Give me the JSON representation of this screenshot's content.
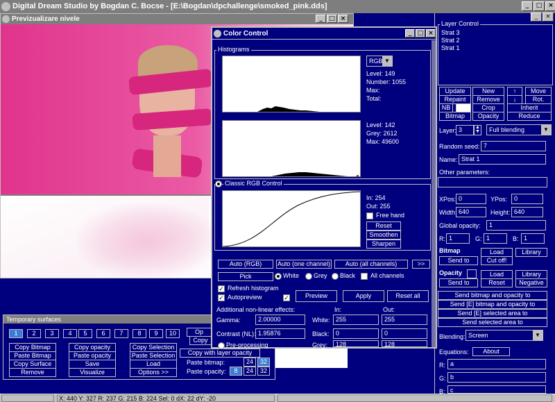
{
  "app": {
    "title": "Digital Dream Studio by Bogdan C. Bocse - [E:\\Bogdan\\dpchallenge\\smoked_pink.dds]"
  },
  "preview": {
    "title": "Previzualizare nivele"
  },
  "color_control": {
    "title": "Color Control",
    "histograms_label": "Histograms",
    "channel": "RGB",
    "top_stats": [
      "Level: 149",
      "Number: 1055",
      "Max:",
      "Total:"
    ],
    "bottom_stats": [
      "Level: 142",
      "Grey: 2612",
      "Max: 49600"
    ],
    "classic_label": "Classic RGB Control",
    "in": "In: 254",
    "out": "Out: 255",
    "free_hand": "Free hand",
    "reset": "Reset",
    "smoothen": "Smoothen",
    "sharpen": "Sharpen",
    "auto_rgb": "Auto (RGB)",
    "auto_one": "Auto (one channel)",
    "auto_all": "Auto (all channels)",
    "more": ">>",
    "pick": "Pick",
    "white": "White",
    "grey": "Grey",
    "black": "Black",
    "all_channels": "All channels",
    "refresh": "Refresh histogram",
    "autopreview": "Autopreview",
    "preview_btn": "Preview",
    "apply": "Apply",
    "reset_all": "Reset all",
    "nonlinear": "Additional non-linear effects:",
    "in_col": "In:",
    "out_col": "Out:",
    "gamma_label": "Gamma:",
    "gamma": "2.00000",
    "contrast_label": "Contrast (NL):",
    "contrast": "1.95876",
    "white_label": "White:",
    "white_in": "255",
    "white_out": "255",
    "black_label": "Black:",
    "black_in": "0",
    "black_out": "0",
    "grey_label": "Grey:",
    "grey_in": "128",
    "grey_out": "128",
    "preprocessing": "Pre-processing"
  },
  "temp": {
    "title": "Temporary surfaces",
    "numbers": [
      "1",
      "2",
      "3",
      "4",
      "5",
      "6",
      "7",
      "8",
      "9",
      "10"
    ],
    "col1": [
      "Copy Bitmap",
      "Paste Bitmap",
      "Copy Surface",
      "Remove"
    ],
    "col2": [
      "Copy opacity",
      "Paste opacity",
      "Save",
      "Visualize"
    ],
    "col3": [
      "Copy Selection",
      "Paste Selection",
      "Load",
      "Options >>"
    ],
    "op": "Op",
    "copy": "Copy",
    "copy_with_layer": "Copy with layer opacity",
    "paste_bitmap": "Paste bitmap:",
    "paste_opacity": "Paste opacity:",
    "b24": "24",
    "b32": "32",
    "b8": "8"
  },
  "layer": {
    "title": "Layer Control",
    "strata": [
      "Strat 3",
      "Strat 2",
      "Strat 1"
    ],
    "update": "Update",
    "new": "New",
    "up": "↑",
    "move": "Move",
    "repaint": "Repaint",
    "remove": "Remove",
    "down": "↓",
    "rot": "Rot.",
    "nb": "NB",
    "crop": "Crop",
    "inherit": "Inherit",
    "bitmap": "Bitmap",
    "opacity": "Opacity",
    "reduce": "Reduce",
    "layer_label": "Layer:",
    "layer_value": "3",
    "blending_mode": "Full blending",
    "seed_label": "Random seed:",
    "seed": "7",
    "name_label": "Name:",
    "name": "Strat 1",
    "other": "Other parameters:",
    "xpos_label": "XPos:",
    "xpos": "0",
    "ypos_label": "YPos:",
    "ypos": "0",
    "width_label": "Width:",
    "width": "640",
    "height_label": "Height:",
    "height": "640",
    "global_label": "Global opacity:",
    "global": "1",
    "r_label": "R:",
    "r": "1",
    "g_label": "G:",
    "g": "1",
    "b_label": "B:",
    "b": "1",
    "bitmap_head": "Bitmap",
    "load": "Load",
    "library": "Library",
    "send_to": "Send to",
    "cut_off": "Cut off!",
    "opacity_head": "Opacity",
    "load2": "Load",
    "library2": "Library",
    "send_to2": "Send to",
    "reset": "Reset",
    "negative": "Negative",
    "send1": "Send bitmap and opacity to",
    "send2": "Send [E] bitmap and opacity to",
    "send3": "Send [E] selected area to",
    "send4": "Send selected area to",
    "blending_label": "Blending:",
    "blending": "Screen",
    "equations": "Equations:",
    "about": "About",
    "eq_r_label": "R:",
    "eq_r": "a",
    "eq_g_label": "G:",
    "eq_g": "b",
    "eq_b_label": "B:",
    "eq_b": "c"
  },
  "status": {
    "text": "X: 440 Y: 327 R: 237 G: 215 B: 224 Sel: 0 dX: 22 dY: -20"
  }
}
